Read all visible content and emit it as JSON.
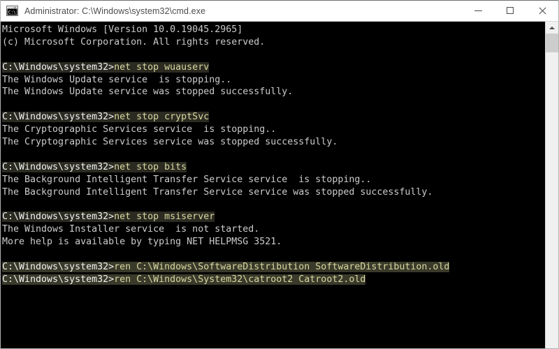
{
  "window": {
    "title": "Administrator: C:\\Windows\\system32\\cmd.exe",
    "icon": "cmd-console-icon",
    "controls": {
      "minimize": "Minimize",
      "maximize": "Maximize",
      "close": "Close"
    },
    "titlebar_bg": "#ffffff",
    "title_color": "#4d4d4d"
  },
  "console": {
    "background": "#000000",
    "foreground": "#cccccc",
    "command_color": "#d8d8a0",
    "highlight_color": "#35352a",
    "lines": [
      {
        "id": "l1",
        "type": "output",
        "text": "Microsoft Windows [Version 10.0.19045.2965]"
      },
      {
        "id": "l2",
        "type": "output",
        "text": "(c) Microsoft Corporation. All rights reserved."
      },
      {
        "id": "l3",
        "type": "blank",
        "text": " "
      },
      {
        "id": "l4",
        "type": "command",
        "highlight": "dark",
        "prompt": "C:\\Windows\\system32>",
        "command": "net stop wuauserv"
      },
      {
        "id": "l5",
        "type": "output",
        "text": "The Windows Update service  is stopping.."
      },
      {
        "id": "l6",
        "type": "output",
        "text": "The Windows Update service was stopped successfully."
      },
      {
        "id": "l7",
        "type": "blank",
        "text": " "
      },
      {
        "id": "l8",
        "type": "command",
        "highlight": "dark",
        "prompt": "C:\\Windows\\system32>",
        "command": "net stop cryptSvc"
      },
      {
        "id": "l9",
        "type": "output",
        "text": "The Cryptographic Services service  is stopping.."
      },
      {
        "id": "l10",
        "type": "output",
        "text": "The Cryptographic Services service was stopped successfully."
      },
      {
        "id": "l11",
        "type": "blank",
        "text": " "
      },
      {
        "id": "l12",
        "type": "command",
        "highlight": "dark",
        "prompt": "C:\\Windows\\system32>",
        "command": "net stop bits"
      },
      {
        "id": "l13",
        "type": "output",
        "text": "The Background Intelligent Transfer Service service  is stopping.."
      },
      {
        "id": "l14",
        "type": "output",
        "text": "The Background Intelligent Transfer Service service was stopped successfully."
      },
      {
        "id": "l15",
        "type": "blank",
        "text": " "
      },
      {
        "id": "l16",
        "type": "command",
        "highlight": "dark",
        "prompt": "C:\\Windows\\system32>",
        "command": "net stop msiserver"
      },
      {
        "id": "l17",
        "type": "output",
        "text": "The Windows Installer service  is not started."
      },
      {
        "id": "l18",
        "type": "output",
        "text": "More help is available by typing NET HELPMSG 3521."
      },
      {
        "id": "l19",
        "type": "blank",
        "text": " "
      },
      {
        "id": "l20",
        "type": "command",
        "highlight": "warm",
        "full_highlight": true,
        "prompt": "C:\\Windows\\system32>",
        "command": "ren C:\\Windows\\SoftwareDistribution SoftwareDistribution.old"
      },
      {
        "id": "l21",
        "type": "command",
        "highlight": "warm",
        "full_highlight": true,
        "prompt": "C:\\Windows\\system32>",
        "command": "ren C:\\Windows\\System32\\catroot2 Catroot2.old"
      }
    ]
  },
  "scrollbar": {
    "up_arrow": "scroll-up-arrow",
    "thumb_position_pct": 0,
    "thumb_size_pct": 6
  }
}
